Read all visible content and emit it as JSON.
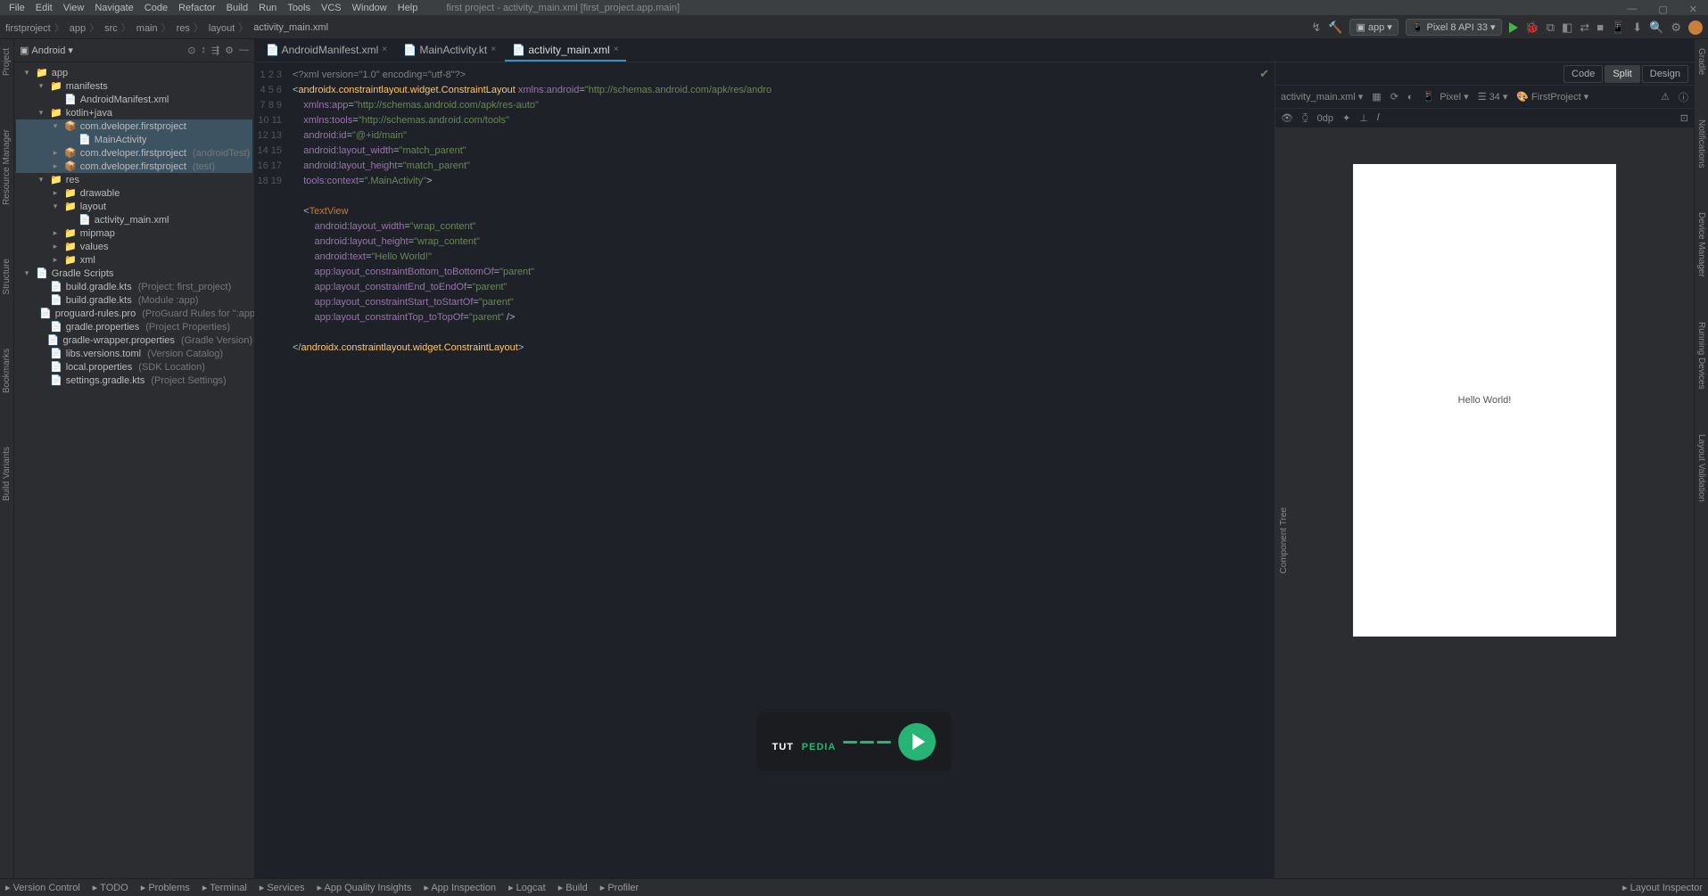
{
  "menubar": {
    "items": [
      "File",
      "Edit",
      "View",
      "Navigate",
      "Code",
      "Refactor",
      "Build",
      "Run",
      "Tools",
      "VCS",
      "Window",
      "Help"
    ],
    "title": "first project - activity_main.xml [first_project.app.main]"
  },
  "toolbar": {
    "crumbs": [
      "firstproject",
      "app",
      "src",
      "main",
      "res",
      "layout",
      "activity_main.xml"
    ],
    "run_config": "app",
    "device": "Pixel 8 API 33"
  },
  "projpane": {
    "selector": "Android",
    "tree": [
      {
        "d": 0,
        "ar": "▾",
        "ico": "📁",
        "t": "app"
      },
      {
        "d": 1,
        "ar": "▾",
        "ico": "📁",
        "t": "manifests"
      },
      {
        "d": 2,
        "ar": "",
        "ico": "📄",
        "t": "AndroidManifest.xml"
      },
      {
        "d": 1,
        "ar": "▾",
        "ico": "📁",
        "t": "kotlin+java"
      },
      {
        "d": 2,
        "ar": "▾",
        "ico": "📦",
        "t": "com.dveloper.firstproject",
        "sel": true
      },
      {
        "d": 3,
        "ar": "",
        "ico": "📄",
        "t": "MainActivity",
        "sel": true
      },
      {
        "d": 2,
        "ar": "▸",
        "ico": "📦",
        "t": "com.dveloper.firstproject",
        "hint": "(androidTest)",
        "sel": true
      },
      {
        "d": 2,
        "ar": "▸",
        "ico": "📦",
        "t": "com.dveloper.firstproject",
        "hint": "(test)",
        "sel": true
      },
      {
        "d": 1,
        "ar": "▾",
        "ico": "📁",
        "t": "res"
      },
      {
        "d": 2,
        "ar": "▸",
        "ico": "📁",
        "t": "drawable"
      },
      {
        "d": 2,
        "ar": "▾",
        "ico": "📁",
        "t": "layout"
      },
      {
        "d": 3,
        "ar": "",
        "ico": "📄",
        "t": "activity_main.xml"
      },
      {
        "d": 2,
        "ar": "▸",
        "ico": "📁",
        "t": "mipmap"
      },
      {
        "d": 2,
        "ar": "▸",
        "ico": "📁",
        "t": "values"
      },
      {
        "d": 2,
        "ar": "▸",
        "ico": "📁",
        "t": "xml"
      },
      {
        "d": 0,
        "ar": "▾",
        "ico": "📄",
        "t": "Gradle Scripts"
      },
      {
        "d": 1,
        "ar": "",
        "ico": "📄",
        "t": "build.gradle.kts",
        "hint": "(Project: first_project)"
      },
      {
        "d": 1,
        "ar": "",
        "ico": "📄",
        "t": "build.gradle.kts",
        "hint": "(Module :app)"
      },
      {
        "d": 1,
        "ar": "",
        "ico": "📄",
        "t": "proguard-rules.pro",
        "hint": "(ProGuard Rules for \":app\")"
      },
      {
        "d": 1,
        "ar": "",
        "ico": "📄",
        "t": "gradle.properties",
        "hint": "(Project Properties)"
      },
      {
        "d": 1,
        "ar": "",
        "ico": "📄",
        "t": "gradle-wrapper.properties",
        "hint": "(Gradle Version)"
      },
      {
        "d": 1,
        "ar": "",
        "ico": "📄",
        "t": "libs.versions.toml",
        "hint": "(Version Catalog)"
      },
      {
        "d": 1,
        "ar": "",
        "ico": "📄",
        "t": "local.properties",
        "hint": "(SDK Location)"
      },
      {
        "d": 1,
        "ar": "",
        "ico": "📄",
        "t": "settings.gradle.kts",
        "hint": "(Project Settings)"
      }
    ]
  },
  "tabs": [
    {
      "label": "AndroidManifest.xml",
      "ico": "📄"
    },
    {
      "label": "MainActivity.kt",
      "ico": "📄"
    },
    {
      "label": "activity_main.xml",
      "ico": "📄",
      "active": true
    }
  ],
  "design_tabs": {
    "code": "Code",
    "split": "Split",
    "design": "Design"
  },
  "design_bar": {
    "file": "activity_main.xml",
    "device": "Pixel",
    "zoom": "34",
    "project": "FirstProject",
    "px": "0dp"
  },
  "phone_text": "Hello World!",
  "component_tree": "Component Tree",
  "left_rail": [
    "Project",
    "Resource Manager",
    "Structure",
    "Bookmarks",
    "Build Variants"
  ],
  "right_rail": [
    "Gradle",
    "Notifications",
    "Device Manager",
    "Running Devices",
    "Layout Validation"
  ],
  "bottom": [
    "Version Control",
    "TODO",
    "Problems",
    "Terminal",
    "Services",
    "App Quality Insights",
    "App Inspection",
    "Logcat",
    "Build",
    "Profiler"
  ],
  "bottom_right": "Layout Inspector",
  "code_lines": [
    {
      "n": 1,
      "html": "<span class='comment'>&lt;?xml version=\"1.0\" encoding=\"utf-8\"?&gt;</span>"
    },
    {
      "n": 2,
      "html": "&lt;<span class='highlight'>androidx.constraintlayout.widget.ConstraintLayout</span> <span class='attr'>xmlns:android</span>=<span class='str'>\"http://schemas.android.com/apk/res/andro</span>"
    },
    {
      "n": 3,
      "html": "    <span class='attr'>xmlns:app</span>=<span class='str'>\"http://schemas.android.com/apk/res-auto\"</span>"
    },
    {
      "n": 4,
      "html": "    <span class='attr'>xmlns:tools</span>=<span class='str'>\"http://schemas.android.com/tools\"</span>"
    },
    {
      "n": 5,
      "html": "    <span class='attr'>android:id</span>=<span class='str'>\"@+id/main\"</span>"
    },
    {
      "n": 6,
      "html": "    <span class='attr'>android:layout_width</span>=<span class='str'>\"match_parent\"</span>"
    },
    {
      "n": 7,
      "html": "    <span class='attr'>android:layout_height</span>=<span class='str'>\"match_parent\"</span>"
    },
    {
      "n": 8,
      "html": "    <span class='attr'>tools:context</span>=<span class='str'>\".MainActivity\"</span>&gt;"
    },
    {
      "n": 9,
      "html": ""
    },
    {
      "n": 10,
      "html": "    &lt;<span class='tag'>TextView</span>"
    },
    {
      "n": 11,
      "html": "        <span class='attr'>android:layout_width</span>=<span class='str'>\"wrap_content\"</span>"
    },
    {
      "n": 12,
      "html": "        <span class='attr'>android:layout_height</span>=<span class='str'>\"wrap_content\"</span>"
    },
    {
      "n": 13,
      "html": "        <span class='attr'>android:text</span>=<span class='str'>\"Hello World!\"</span>"
    },
    {
      "n": 14,
      "html": "        <span class='attr'>app:layout_constraintBottom_toBottomOf</span>=<span class='str'>\"parent\"</span>"
    },
    {
      "n": 15,
      "html": "        <span class='attr'>app:layout_constraintEnd_toEndOf</span>=<span class='str'>\"parent\"</span>"
    },
    {
      "n": 16,
      "html": "        <span class='attr'>app:layout_constraintStart_toStartOf</span>=<span class='str'>\"parent\"</span>"
    },
    {
      "n": 17,
      "html": "        <span class='attr'>app:layout_constraintTop_toTopOf</span>=<span class='str'>\"parent\"</span> /&gt;"
    },
    {
      "n": 18,
      "html": ""
    },
    {
      "n": 19,
      "html": "&lt;/<span class='highlight'>androidx.constraintlayout.widget.ConstraintLayout</span>&gt;"
    }
  ],
  "watermark": {
    "t1": "TUT",
    "t2": "PEDIA"
  }
}
